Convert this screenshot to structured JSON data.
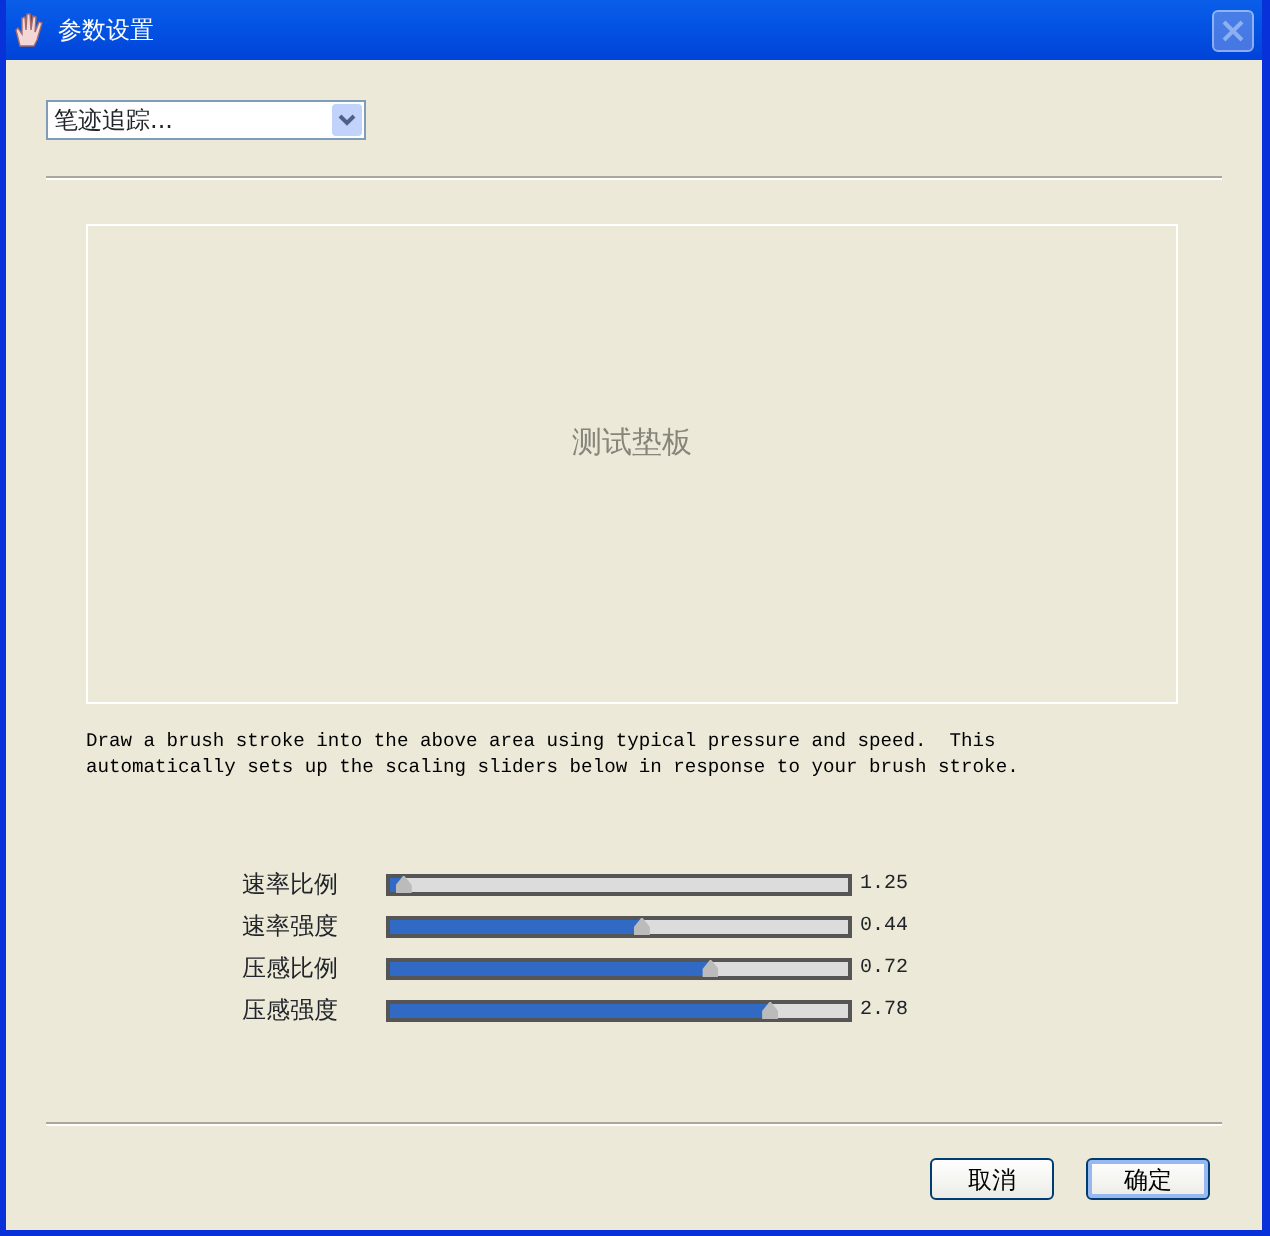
{
  "window": {
    "title": "参数设置",
    "close_disabled": true
  },
  "dropdown": {
    "value": "笔迹追踪..."
  },
  "pad": {
    "label": "测试垫板"
  },
  "description": "Draw a brush stroke into the above area using typical pressure and speed.  This\nautomatically sets up the scaling sliders below in response to your brush stroke.",
  "sliders": [
    {
      "label": "速率比例",
      "level": 0.03,
      "reading": "1.25"
    },
    {
      "label": "速率强度",
      "level": 0.55,
      "reading": "0.44"
    },
    {
      "label": "压感比例",
      "level": 0.7,
      "reading": "0.72"
    },
    {
      "label": "压感强度",
      "level": 0.83,
      "reading": "2.78"
    }
  ],
  "buttons": [
    {
      "label": "取消",
      "default": false
    },
    {
      "label": "确定",
      "default": true
    }
  ]
}
